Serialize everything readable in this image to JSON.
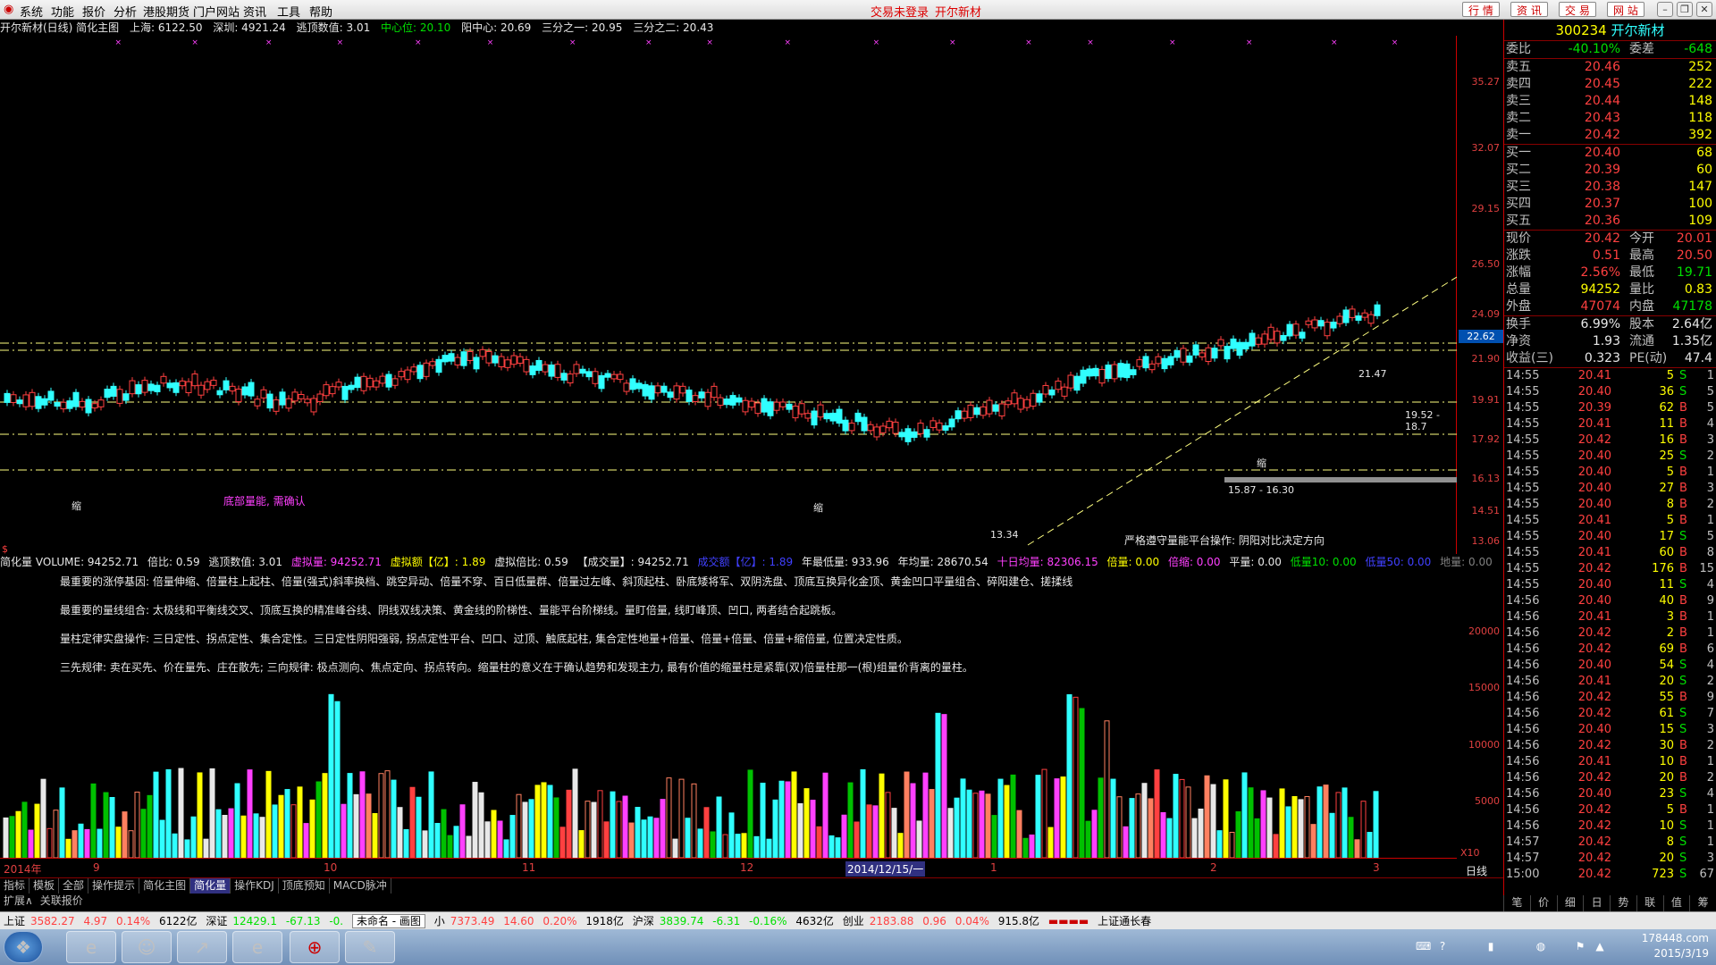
{
  "menu": {
    "items": [
      "系统",
      "功能",
      "报价",
      "分析",
      "港股期货",
      "门户网站",
      "资讯",
      "工具",
      "帮助"
    ],
    "center_msg_1": "交易未登录",
    "center_msg_2": "开尔新材",
    "right_tabs": [
      "行 情",
      "资 讯",
      "交 易",
      "网 站"
    ]
  },
  "infoline": {
    "title": "开尔新材(日线) 简化主图",
    "sh": "上海: 6122.50",
    "sz": "深圳: 4921.24",
    "escape": "逃顶数值: 3.01",
    "center": "中心位: 20.10",
    "yang": "阳中心: 20.69",
    "third1": "三分之一: 20.95",
    "third2": "三分之二: 20.43"
  },
  "price_axis": [
    "35.27",
    "32.07",
    "29.15",
    "26.50",
    "24.09",
    "21.90",
    "19.91",
    "17.92",
    "16.13",
    "14.51",
    "13.06"
  ],
  "price_highlight": "22.62",
  "chart_labels": {
    "high_price": "21.47",
    "low_price": "13.34",
    "range1": "19.52 - 18.7",
    "range2": "15.87 - 16.30",
    "annotation": "严格遵守量能平台操作: 阴阳对比决定方向",
    "confirm": "底部量能, 需确认",
    "shrink": "缩",
    "dollar": "$"
  },
  "volinfo": {
    "main": "简化量 VOLUME: 94252.71",
    "ratio": "倍比: 0.59",
    "escape": "逃顶数值: 3.01",
    "virtual": "虚拟量: 94252.71",
    "virtual_amt": "虚拟额【亿】: 1.89",
    "virtual_ratio": "虚拟倍比: 0.59",
    "deal": "【成交量】: 94252.71",
    "deal_amt": "成交额【亿】: 1.89",
    "year_min": "年最低量: 933.96",
    "year_avg": "年均量: 28670.54",
    "ten_avg": "十日均量: 82306.15",
    "bei": "倍量: 0.00",
    "bei_shrink": "倍缩: 0.00",
    "flat": "平量: 0.00",
    "low10": "低量10: 0.00",
    "low50": "低量50: 0.00",
    "ground": "地量: 0.00"
  },
  "notes": [
    "最重要的涨停基因: 倍量伸缩、倍量柱上起柱、倍量(强式)斜率换档、跳空异动、倍量不穿、百日低量群、倍量过左峰、斜顶起柱、卧底矮将军、双阴洗盘、顶底互换异化金顶、黄金凹口平量组合、碎阳建仓、搓揉线",
    "最重要的量线组合: 太极线和平衡线交叉、顶底互换的精准峰谷线、阴线双线决策、黄金线的阶梯性、量能平台阶梯线。量盯倍量, 线盯峰顶、凹口, 两者结合起跳板。",
    "量柱定律实盘操作: 三日定性、拐点定性、集合定性。三日定性阴阳强弱, 拐点定性平台、凹口、过顶、触底起柱, 集合定性地量+倍量、倍量+倍量、倍量+缩倍量, 位置决定性质。",
    "三先规律: 卖在买先、价在量先、庄在散先; 三向规律: 极点测向、焦点定向、拐点转向。缩量柱的意义在于确认趋势和发现主力, 最有价值的缩量柱是紧靠(双)倍量柱那一(根)组量价背离的量柱。"
  ],
  "vol_axis": [
    "20000",
    "15000",
    "10000",
    "5000",
    "X10"
  ],
  "dates": [
    "2014年",
    "9",
    "10",
    "11",
    "12",
    "2014/12/15/一",
    "1",
    "2",
    "3",
    "日线"
  ],
  "quote": {
    "code": "300234",
    "name": "开尔新材",
    "weibi_label": "委比",
    "weibi": "-40.10%",
    "weicha_label": "委差",
    "weicha": "-648",
    "sells": [
      {
        "label": "卖五",
        "price": "20.46",
        "qty": "252"
      },
      {
        "label": "卖四",
        "price": "20.45",
        "qty": "222"
      },
      {
        "label": "卖三",
        "price": "20.44",
        "qty": "148"
      },
      {
        "label": "卖二",
        "price": "20.43",
        "qty": "118"
      },
      {
        "label": "卖一",
        "price": "20.42",
        "qty": "392"
      }
    ],
    "buys": [
      {
        "label": "买一",
        "price": "20.40",
        "qty": "68"
      },
      {
        "label": "买二",
        "price": "20.39",
        "qty": "60"
      },
      {
        "label": "买三",
        "price": "20.38",
        "qty": "147"
      },
      {
        "label": "买四",
        "price": "20.37",
        "qty": "100"
      },
      {
        "label": "买五",
        "price": "20.36",
        "qty": "109"
      }
    ],
    "stats": [
      {
        "l1": "现价",
        "v1": "20.42",
        "l2": "今开",
        "v2": "20.01"
      },
      {
        "l1": "涨跌",
        "v1": "0.51",
        "l2": "最高",
        "v2": "20.50"
      },
      {
        "l1": "涨幅",
        "v1": "2.56%",
        "l2": "最低",
        "v2": "19.71"
      },
      {
        "l1": "总量",
        "v1": "94252",
        "l2": "量比",
        "v2": "0.83"
      },
      {
        "l1": "外盘",
        "v1": "47074",
        "l2": "内盘",
        "v2": "47178"
      }
    ],
    "stats2": [
      {
        "l1": "换手",
        "v1": "6.99%",
        "l2": "股本",
        "v2": "2.64亿"
      },
      {
        "l1": "净资",
        "v1": "1.93",
        "l2": "流通",
        "v2": "1.35亿"
      },
      {
        "l1": "收益(三)",
        "v1": "0.323",
        "l2": "PE(动)",
        "v2": "47.4"
      }
    ],
    "ticks": [
      [
        "14:55",
        "20.41",
        "5",
        "S",
        "1"
      ],
      [
        "14:55",
        "20.40",
        "36",
        "S",
        "5"
      ],
      [
        "14:55",
        "20.39",
        "62",
        "B",
        "5"
      ],
      [
        "14:55",
        "20.41",
        "11",
        "B",
        "4"
      ],
      [
        "14:55",
        "20.42",
        "16",
        "B",
        "3"
      ],
      [
        "14:55",
        "20.40",
        "25",
        "S",
        "2"
      ],
      [
        "14:55",
        "20.40",
        "5",
        "B",
        "1"
      ],
      [
        "14:55",
        "20.40",
        "27",
        "B",
        "3"
      ],
      [
        "14:55",
        "20.40",
        "8",
        "B",
        "2"
      ],
      [
        "14:55",
        "20.41",
        "5",
        "B",
        "1"
      ],
      [
        "14:55",
        "20.40",
        "17",
        "S",
        "5"
      ],
      [
        "14:55",
        "20.41",
        "60",
        "B",
        "8"
      ],
      [
        "14:55",
        "20.42",
        "176",
        "B",
        "15"
      ],
      [
        "14:55",
        "20.40",
        "11",
        "S",
        "4"
      ],
      [
        "14:56",
        "20.40",
        "40",
        "B",
        "9"
      ],
      [
        "14:56",
        "20.41",
        "3",
        "B",
        "1"
      ],
      [
        "14:56",
        "20.42",
        "2",
        "B",
        "1"
      ],
      [
        "14:56",
        "20.42",
        "69",
        "B",
        "6"
      ],
      [
        "14:56",
        "20.40",
        "54",
        "S",
        "4"
      ],
      [
        "14:56",
        "20.41",
        "20",
        "S",
        "2"
      ],
      [
        "14:56",
        "20.42",
        "55",
        "B",
        "9"
      ],
      [
        "14:56",
        "20.42",
        "61",
        "S",
        "7"
      ],
      [
        "14:56",
        "20.40",
        "15",
        "S",
        "3"
      ],
      [
        "14:56",
        "20.42",
        "30",
        "B",
        "2"
      ],
      [
        "14:56",
        "20.41",
        "10",
        "B",
        "1"
      ],
      [
        "14:56",
        "20.42",
        "20",
        "B",
        "2"
      ],
      [
        "14:56",
        "20.40",
        "23",
        "S",
        "4"
      ],
      [
        "14:56",
        "20.42",
        "5",
        "B",
        "1"
      ],
      [
        "14:56",
        "20.42",
        "10",
        "S",
        "1"
      ],
      [
        "14:57",
        "20.42",
        "8",
        "S",
        "1"
      ],
      [
        "14:57",
        "20.42",
        "20",
        "S",
        "3"
      ],
      [
        "15:00",
        "20.42",
        "723",
        "S",
        "67"
      ]
    ]
  },
  "tabs_row1": [
    "指标",
    "模板",
    "全部",
    "操作提示",
    "简化主图",
    "简化量",
    "操作KDJ",
    "顶底预知",
    "MACD脉冲"
  ],
  "tabs_row2": [
    "扩展∧",
    "关联报价"
  ],
  "quote_tabs": [
    "笔",
    "价",
    "细",
    "日",
    "势",
    "联",
    "值",
    "筹"
  ],
  "statusbar": {
    "sh_label": "上证",
    "sh": "3582.27",
    "sh_chg": "4.97",
    "sh_pct": "0.14%",
    "sh_amt": "6122亿",
    "sz_label": "深证",
    "sz": "12429.1",
    "sz_chg": "-67.13",
    "sz_pct": "-0.",
    "tab_unnamed": "未命名 - 画图",
    "zx_label": "小",
    "zx": "7373.49",
    "zx_chg": "14.60",
    "zx_pct": "0.20%",
    "zx_amt": "1918亿",
    "hs_label": "沪深",
    "hs": "3839.74",
    "hs_chg": "-6.31",
    "hs_pct": "-0.16%",
    "hs_amt": "4632亿",
    "cy_label": "创业",
    "cy": "2183.88",
    "cy_chg": "0.96",
    "cy_pct": "0.04%",
    "cy_amt": "915.8亿",
    "ticker": "上证通长春"
  },
  "taskbar": {
    "clock_time": "178448.com",
    "clock_date": "2015/3/19"
  }
}
